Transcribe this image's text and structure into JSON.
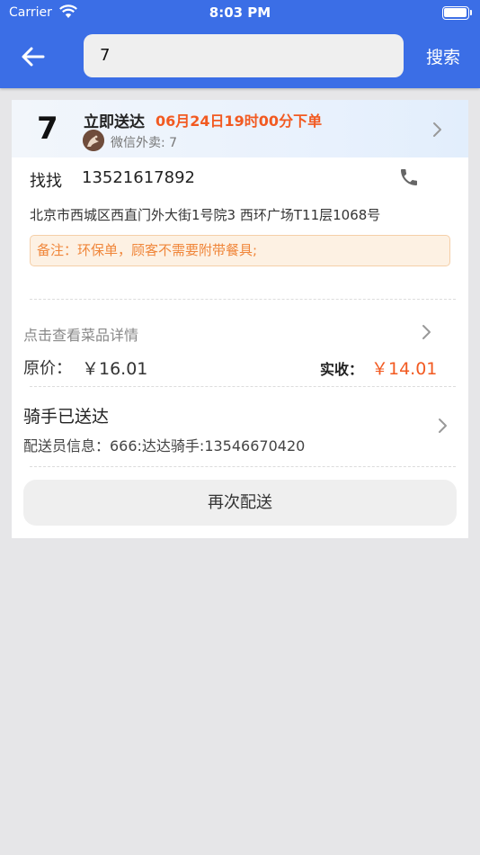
{
  "status_bar": {
    "carrier": "Carrier",
    "time": "8:03 PM"
  },
  "header": {
    "search_value": "7",
    "search_button": "搜索"
  },
  "order": {
    "number": "7",
    "delivery_type": "立即送达",
    "order_time": "06月24日19时00分下单",
    "platform": "微信外卖: 7",
    "customer_name": "找找",
    "customer_phone": "13521617892",
    "address": "北京市西城区西直门外大街1号院3 西环广场T11层1068号",
    "remark": "备注：环保单，顾客不需要附带餐具;",
    "dish_link": "点击查看菜品详情",
    "original_price_label": "原价：",
    "original_price": "￥16.01",
    "paid_label": "实收：",
    "paid_amount": "￥14.01",
    "rider_status": "骑手已送达",
    "rider_info": "配送员信息：666:达达骑手:13546670420",
    "redeliver_button": "再次配送"
  },
  "colors": {
    "header_bg": "#3b6ee6",
    "accent": "#f25a21",
    "remark_text": "#f0863a"
  },
  "icons": [
    "wifi-icon",
    "battery-icon",
    "back-arrow-icon",
    "chevron-right-icon",
    "phone-icon",
    "platform-avatar"
  ]
}
